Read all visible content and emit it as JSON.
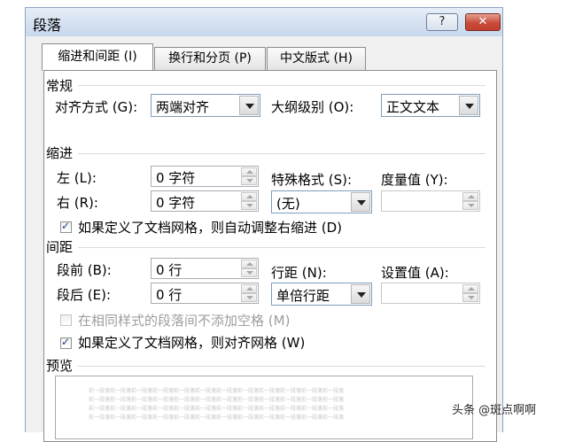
{
  "window": {
    "title": "段落",
    "help_label": "?",
    "close_label": "✕"
  },
  "tabs": [
    {
      "label": "缩进和间距 (I)"
    },
    {
      "label": "换行和分页 (P)"
    },
    {
      "label": "中文版式 (H)"
    }
  ],
  "general": {
    "section_title": "常规",
    "alignment_label": "对齐方式 (G):",
    "alignment_value": "两端对齐",
    "outline_label": "大纲级别 (O):",
    "outline_value": "正文文本"
  },
  "indent": {
    "section_title": "缩进",
    "left_label": "左 (L):",
    "left_value": "0 字符",
    "right_label": "右 (R):",
    "right_value": "0 字符",
    "special_label": "特殊格式 (S):",
    "special_value": "(无)",
    "amount_label": "度量值 (Y):",
    "auto_adjust_label": "如果定义了文档网格，则自动调整右缩进 (D)",
    "auto_adjust_checked": true
  },
  "spacing": {
    "section_title": "间距",
    "before_label": "段前 (B):",
    "before_value": "0 行",
    "after_label": "段后 (E):",
    "after_value": "0 行",
    "line_spacing_label": "行距 (N):",
    "line_spacing_value": "单倍行距",
    "at_label": "设置值 (A):",
    "no_space_same_style_label": "在相同样式的段落间不添加空格 (M)",
    "no_space_same_style_checked": false,
    "snap_grid_label": "如果定义了文档网格，则对齐网格 (W)",
    "snap_grid_checked": true
  },
  "preview": {
    "section_title": "预览",
    "sample_text": "前一段落前一段落前一段落前一段落前一段落前一段落前一段落前一段落前一段落前一段落前一段落前一段落"
  },
  "watermark": "头条 @斑点啊啊"
}
